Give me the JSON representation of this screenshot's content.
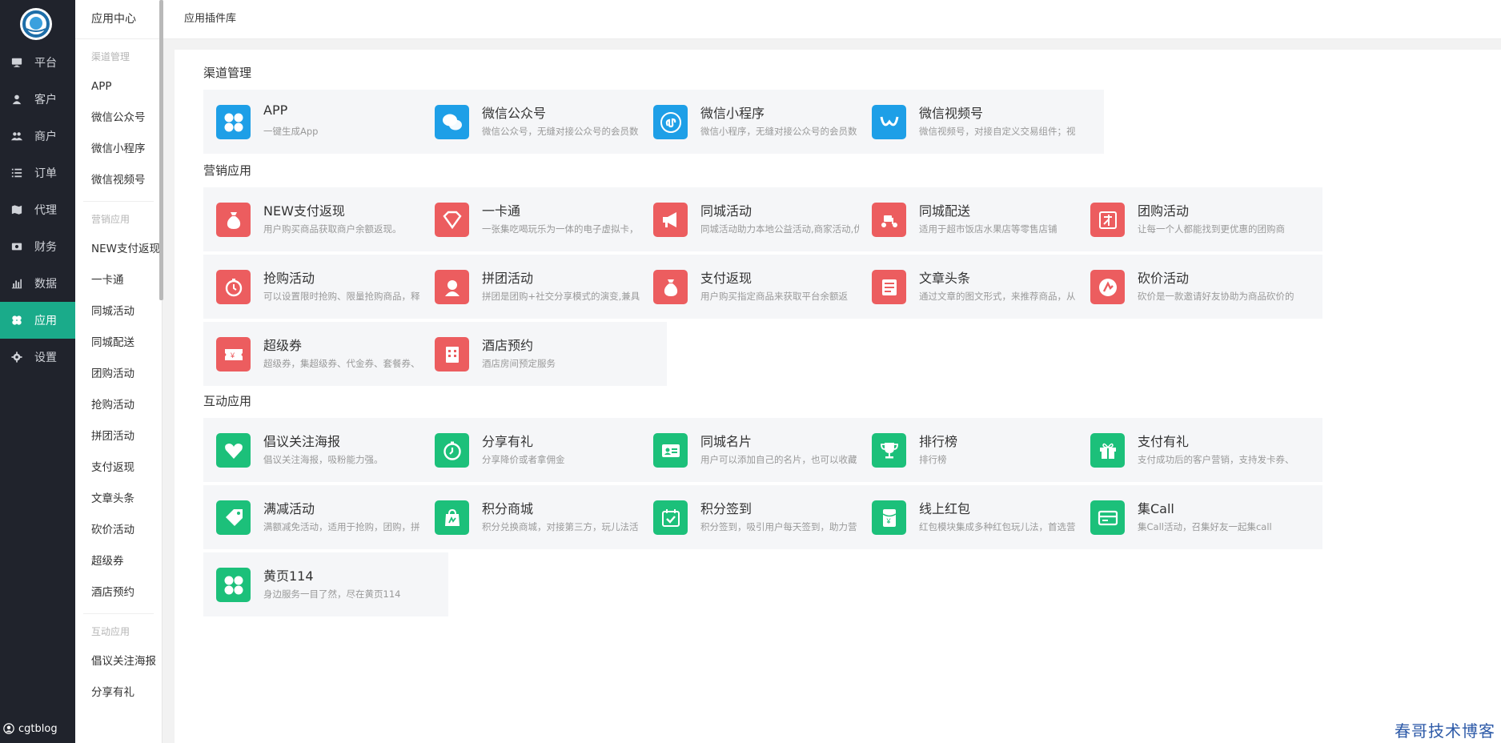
{
  "rail": {
    "nav": [
      {
        "label": "平台",
        "icon": "monitor-icon"
      },
      {
        "label": "客户",
        "icon": "user-icon"
      },
      {
        "label": "商户",
        "icon": "users-icon"
      },
      {
        "label": "订单",
        "icon": "list-icon"
      },
      {
        "label": "代理",
        "icon": "map-icon"
      },
      {
        "label": "财务",
        "icon": "money-icon"
      },
      {
        "label": "数据",
        "icon": "bar-chart-icon"
      },
      {
        "label": "应用",
        "icon": "apps-icon",
        "active": true
      },
      {
        "label": "设置",
        "icon": "gear-icon"
      }
    ],
    "user": "cgtblog"
  },
  "submenu": {
    "title": "应用中心",
    "groups": [
      {
        "head": "渠道管理",
        "items": [
          "APP",
          "微信公众号",
          "微信小程序",
          "微信视频号"
        ]
      },
      {
        "head": "营销应用",
        "items": [
          "NEW支付返现",
          "一卡通",
          "同城活动",
          "同城配送",
          "团购活动",
          "抢购活动",
          "拼团活动",
          "支付返现",
          "文章头条",
          "砍价活动",
          "超级券",
          "酒店预约"
        ]
      },
      {
        "head": "互动应用",
        "items": [
          "倡议关注海报",
          "分享有礼"
        ]
      }
    ]
  },
  "topbar": {
    "breadcrumb": "应用插件库"
  },
  "sections": [
    {
      "title": "渠道管理",
      "cards": [
        {
          "title": "APP",
          "desc": "一键生成App",
          "icon": "clover-icon",
          "color": "blue"
        },
        {
          "title": "微信公众号",
          "desc": "微信公众号，无缝对接公众号的会员数",
          "icon": "wechat-icon",
          "color": "blue"
        },
        {
          "title": "微信小程序",
          "desc": "微信小程序，无缝对接公众号的会员数",
          "icon": "mini-program-icon",
          "color": "blue"
        },
        {
          "title": "微信视频号",
          "desc": "微信视频号，对接自定义交易组件；视",
          "icon": "channels-icon",
          "color": "blue"
        }
      ]
    },
    {
      "title": "营销应用",
      "cards": [
        {
          "title": "NEW支付返现",
          "desc": "用户购买商品获取商户余额返现。",
          "icon": "money-bag-icon",
          "color": "red"
        },
        {
          "title": "一卡通",
          "desc": "一张集吃喝玩乐为一体的电子虚拟卡，",
          "icon": "diamond-icon",
          "color": "red"
        },
        {
          "title": "同城活动",
          "desc": "同城活动助力本地公益活动,商家活动,优",
          "icon": "megaphone-icon",
          "color": "red"
        },
        {
          "title": "同城配送",
          "desc": "适用于超市饭店水果店等零售店铺",
          "icon": "scooter-icon",
          "color": "red"
        },
        {
          "title": "团购活动",
          "desc": "让每一个人都能找到更优惠的团购商",
          "icon": "group-buy-icon",
          "color": "red"
        },
        {
          "title": "抢购活动",
          "desc": "可以设置限时抢购、限量抢购商品，释",
          "icon": "stopwatch-icon",
          "color": "red"
        },
        {
          "title": "拼团活动",
          "desc": "拼团是团购+社交分享模式的演变,兼具",
          "icon": "team-icon",
          "color": "red"
        },
        {
          "title": "支付返现",
          "desc": "用户购买指定商品来获取平台余额返",
          "icon": "money-bag-icon",
          "color": "red"
        },
        {
          "title": "文章头条",
          "desc": "通过文章的图文形式，来推荐商品，从",
          "icon": "article-icon",
          "color": "red"
        },
        {
          "title": "砍价活动",
          "desc": "砍价是一款邀请好友协助为商品砍价的",
          "icon": "bargain-icon",
          "color": "red"
        },
        {
          "title": "超级券",
          "desc": "超级券，集超级券、代金券、套餐券、",
          "icon": "coupon-icon",
          "color": "red"
        },
        {
          "title": "酒店预约",
          "desc": "酒店房间预定服务",
          "icon": "hotel-icon",
          "color": "red"
        }
      ]
    },
    {
      "title": "互动应用",
      "cards": [
        {
          "title": "倡议关注海报",
          "desc": "倡议关注海报，吸粉能力强。",
          "icon": "heart-icon",
          "color": "green"
        },
        {
          "title": "分享有礼",
          "desc": "分享降价或者拿佣金",
          "icon": "timer-icon",
          "color": "green"
        },
        {
          "title": "同城名片",
          "desc": "用户可以添加自己的名片，也可以收藏",
          "icon": "id-card-icon",
          "color": "green"
        },
        {
          "title": "排行榜",
          "desc": "排行榜",
          "icon": "trophy-icon",
          "color": "green"
        },
        {
          "title": "支付有礼",
          "desc": "支付成功后的客户营销，支持发卡券、",
          "icon": "gift-icon",
          "color": "green"
        },
        {
          "title": "满减活动",
          "desc": "满额减免活动，适用于抢购，团购，拼",
          "icon": "tag-icon",
          "color": "green"
        },
        {
          "title": "积分商城",
          "desc": "积分兑换商城，对接第三方，玩儿法活",
          "icon": "shopping-bag-icon",
          "color": "green"
        },
        {
          "title": "积分签到",
          "desc": "积分签到，吸引用户每天签到，助力营",
          "icon": "calendar-check-icon",
          "color": "green"
        },
        {
          "title": "线上红包",
          "desc": "红包模块集成多种红包玩儿法，首选营",
          "icon": "red-packet-icon",
          "color": "green"
        },
        {
          "title": "集Call",
          "desc": "集Call活动，召集好友一起集call",
          "icon": "card-icon",
          "color": "green"
        },
        {
          "title": "黄页114",
          "desc": "身边服务一目了然，尽在黄页114",
          "icon": "clover-icon",
          "color": "green"
        }
      ]
    }
  ],
  "watermark": "春哥技术博客"
}
